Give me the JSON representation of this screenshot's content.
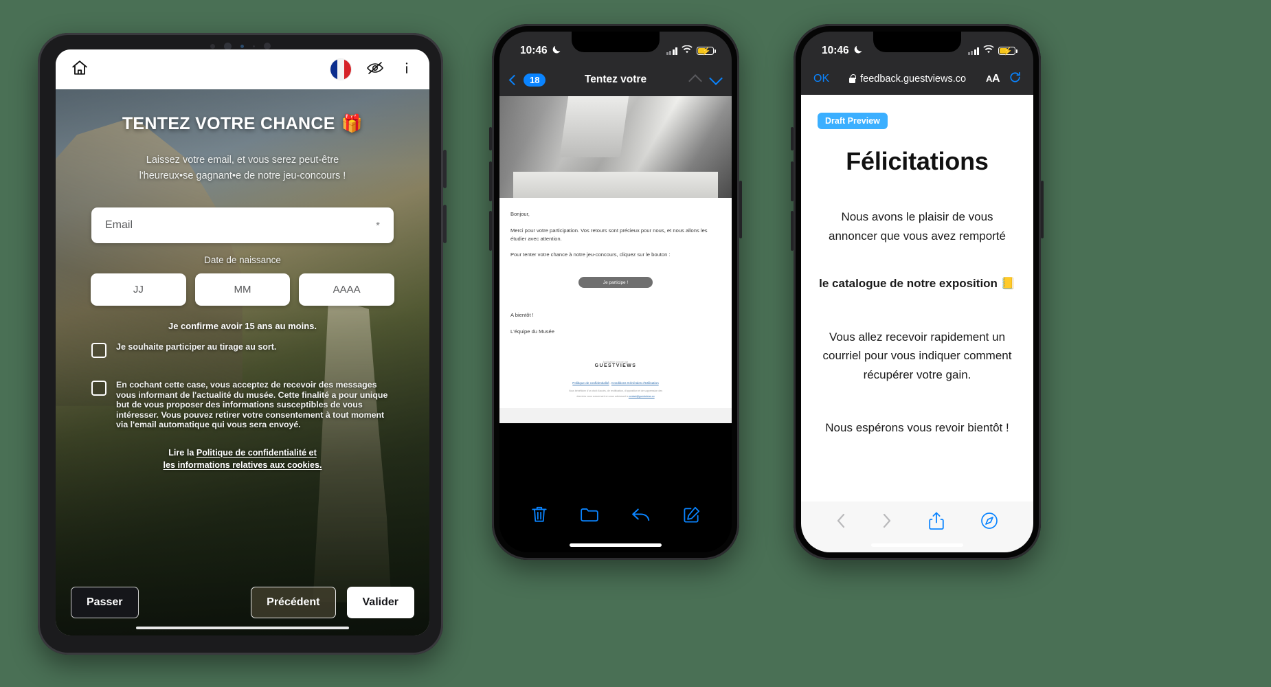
{
  "tablet": {
    "topbar": {
      "home_icon": "home-icon",
      "language_flag": "fr-flag-icon",
      "preview_icon": "eye-preview-icon",
      "info_icon": "info-icon"
    },
    "hero": {
      "title": "TENTEZ VOTRE CHANCE",
      "title_emoji": "🎁",
      "subtitle_line1": "Laissez votre email, et vous serez peut-être",
      "subtitle_line2": "l'heureux•se gagnant•e de notre jeu-concours !",
      "email_placeholder": "Email",
      "email_required_mark": "*",
      "dob_label": "Date de naissance",
      "dob_day_placeholder": "JJ",
      "dob_month_placeholder": "MM",
      "dob_year_placeholder": "AAAA",
      "age_confirm": "Je confirme avoir 15 ans au moins.",
      "checkbox1_label": "Je souhaite participer au tirage au sort.",
      "checkbox2_label": "En cochant cette case, vous acceptez de recevoir des messages vous informant de l'actualité du musée. Cette finalité a pour unique but de vous proposer des informations susceptibles de vous intéresser. Vous pouvez retirer votre consentement à tout moment via l'email automatique qui vous sera envoyé.",
      "policy_prefix": "Lire la ",
      "policy_link_line1": "Politique de confidentialité et",
      "policy_link_line2": "les informations relatives aux cookies."
    },
    "actions": {
      "skip": "Passer",
      "previous": "Précédent",
      "validate": "Valider"
    }
  },
  "phone_mail": {
    "status": {
      "time": "10:46",
      "moon_icon": "crescent-moon-icon",
      "signal_icon": "signal-bars-icon",
      "wifi_icon": "wifi-icon",
      "battery_icon": "battery-charging-icon"
    },
    "nav": {
      "back_icon": "chevron-left-icon",
      "unread_count": "18",
      "title": "Tentez votre",
      "prev_icon": "chevron-up-icon",
      "next_icon": "chevron-down-icon"
    },
    "email": {
      "greeting": "Bonjour,",
      "para1": "Merci pour votre participation. Vos retours sont précieux pour nous, et nous allons les étudier avec attention.",
      "para2": "Pour tenter votre chance à notre jeu-concours, cliquez sur le bouton :",
      "cta": "Je participe !",
      "closing": "A bientôt !",
      "signature": "L'équipe du Musée",
      "brand_small": "Application conçue par",
      "brand": "GUESTVIEWS",
      "footer_link1": "Politique de confidentialité",
      "footer_sep": " - ",
      "footer_link2": "Conditions Générales d'Utilisation",
      "footer_text1": "Vous bénéficiez d'un droit d'accès, de rectification, d'opposition et de suppression des",
      "footer_text2": "données vous concernant en vous adressant à ",
      "footer_mail": "contact@guestviews.co"
    },
    "toolbar": {
      "delete_icon": "trash-icon",
      "move_icon": "folder-icon",
      "reply_icon": "reply-arrow-icon",
      "compose_icon": "compose-pencil-icon"
    }
  },
  "phone_safari": {
    "status": {
      "time": "10:46",
      "moon_icon": "crescent-moon-icon",
      "signal_icon": "signal-bars-icon",
      "wifi_icon": "wifi-icon",
      "battery_icon": "battery-charging-icon"
    },
    "nav": {
      "done_label": "OK",
      "lock_icon": "lock-icon",
      "url": "feedback.guestviews.co",
      "text_size_label": "AA",
      "reload_icon": "reload-icon"
    },
    "page": {
      "badge": "Draft Preview",
      "heading": "Félicitations",
      "para1": "Nous avons le plaisir de vous annoncer que vous avez remporté",
      "prize": "le catalogue de notre exposition",
      "prize_emoji": "📒",
      "para2": "Vous allez recevoir rapidement un courriel pour vous indiquer comment récupérer votre gain.",
      "para3": "Nous espérons vous revoir bientôt !"
    },
    "toolbar": {
      "back_icon": "chevron-left-icon",
      "forward_icon": "chevron-right-icon",
      "share_icon": "share-upload-icon",
      "compass_icon": "compass-icon"
    }
  },
  "background_color": "#4a7055",
  "accent_blue": "#0a84ff"
}
